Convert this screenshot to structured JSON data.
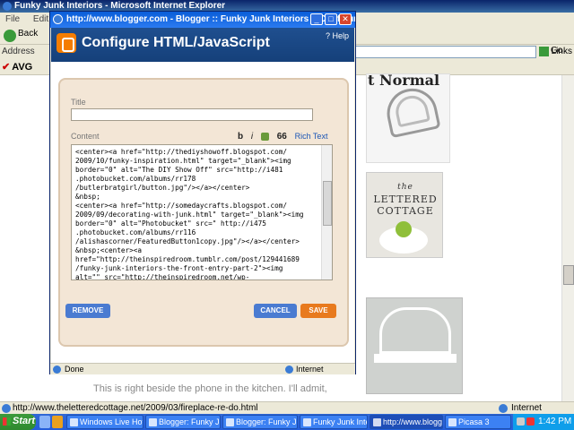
{
  "ie": {
    "title": "Funky Junk Interiors - Microsoft Internet Explorer",
    "menu": [
      "File",
      "Edit"
    ],
    "back_label": "Back",
    "address_label": "Address",
    "go_label": "Go",
    "links_label": "Links",
    "avg_label": "AVG",
    "status_url": "http://www.theletteredcottage.net/2009/03/fireplace-re-do.html",
    "status_zone": "Internet"
  },
  "page": {
    "heading": "t Normal",
    "lettered_cottage_top": "the",
    "lettered_cottage_mid": "LETTERED",
    "lettered_cottage_bot": "COTTAGE",
    "body_text": "This is right beside the phone in the kitchen. I'll admit,"
  },
  "taskbar": {
    "start_label": "Start",
    "tasks": [
      "Windows Live Hotma...",
      "Blogger: Funky Junk ...",
      "Blogger: Funky Junk ...",
      "Funky Junk Interiors ...",
      "http://www.blogg...",
      "Picasa 3"
    ],
    "clock": "1:42 PM"
  },
  "popup": {
    "title": "http://www.blogger.com - Blogger :: Funky Junk Interiors :: Configure HTML/JavaScript",
    "header_title": "Configure HTML/JavaScript",
    "help_label": "? Help",
    "title_label": "Title",
    "title_value": "",
    "content_label": "Content",
    "editor": {
      "bold": "b",
      "italic": "i",
      "quote": "66",
      "rich_text": "Rich Text"
    },
    "content_value": "<center><a href=\"http://thediyshowoff.blogspot.com/\n2009/10/funky-inspiration.html\" target=\"_blank\"><img\nborder=\"0\" alt=\"The DIY Show Off\" src=\"http://i481\n.photobucket.com/albums/rr178\n/butlerbratgirl/button.jpg\"/></a></center>\n&nbsp;\n<center><a href=\"http://somedaycrafts.blogspot.com/\n2009/09/decorating-with-junk.html\" target=\"_blank\"><img\nborder=\"0\" alt=\"Photobucket\" src=\" http://i475\n.photobucket.com/albums/rr116\n/alishascorner/FeaturedButton1copy.jpg\"/></a></center>\n&nbsp;<center><a\nhref=\"http://theinspiredroom.tumblr.com/post/129441689\n/funky-junk-interiors-the-front-entry-part-2\"><img\nalt=\"\" src=\"http://theinspiredroom.net/wp-",
    "remove_label": "REMOVE",
    "cancel_label": "CANCEL",
    "save_label": "SAVE",
    "status_text": "Done",
    "status_zone": "Internet"
  },
  "colors": {
    "blogger_header": "#1f4f8f",
    "panel_bg": "#f3e6d6",
    "button_blue": "#4a7bd1",
    "button_orange": "#e87a1e"
  }
}
